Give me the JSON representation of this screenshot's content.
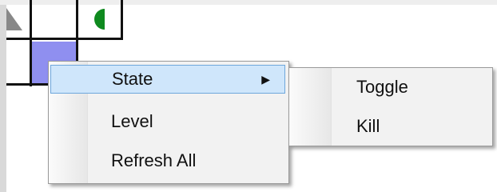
{
  "context_menu": {
    "items": [
      {
        "label": "State",
        "has_submenu": true,
        "submenu_arrow": "▶",
        "highlighted": true
      },
      {
        "label": "Level"
      },
      {
        "label": "Refresh All"
      }
    ]
  },
  "submenu": {
    "items": [
      {
        "label": "Toggle"
      },
      {
        "label": "Kill"
      }
    ]
  },
  "colors": {
    "selected_cell": "#8f8ff0",
    "triangle": "#888888",
    "halfcircle": "#0f8a1f",
    "highlight_bg": "#cfe6fb",
    "highlight_border": "#6ea7dc"
  },
  "icons": {
    "triangle": "gray-triangle-icon",
    "halfcircle": "green-halfcircle-icon",
    "submenu_arrow": "chevron-right-icon"
  }
}
